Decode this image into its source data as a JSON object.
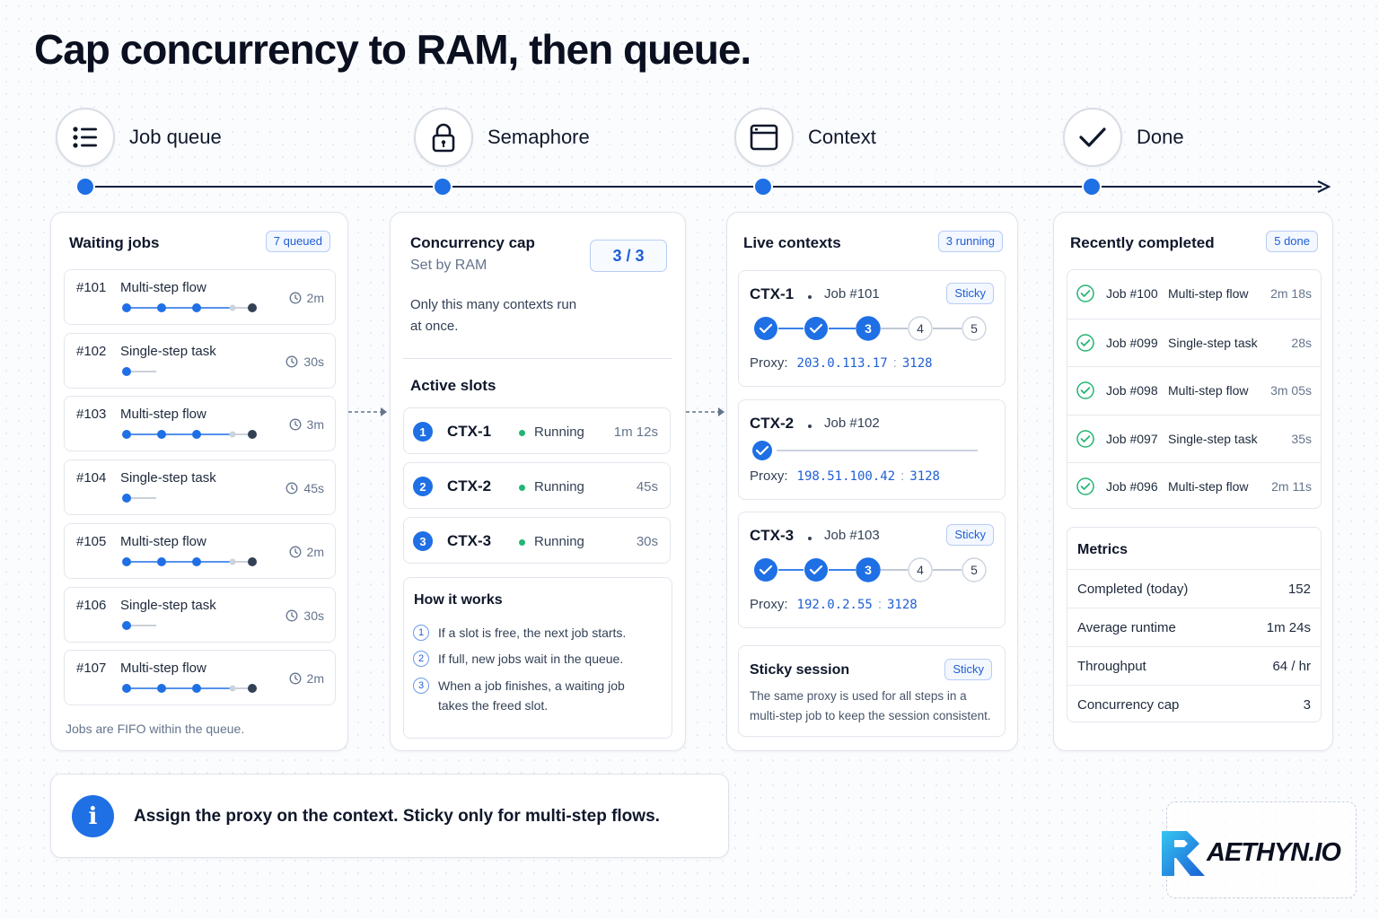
{
  "title": "Cap concurrency to RAM, then queue.",
  "stages": [
    {
      "label": "Job queue",
      "icon": "list-icon"
    },
    {
      "label": "Semaphore",
      "icon": "lock-icon"
    },
    {
      "label": "Context",
      "icon": "browser-window-icon"
    },
    {
      "label": "Done",
      "icon": "checkmark-icon"
    }
  ],
  "colors": {
    "accent": "#1f6fe5",
    "running": "#22b573",
    "done": "#22b573",
    "line": "#0f1f3d"
  },
  "waiting": {
    "title": "Waiting jobs",
    "badge": "7 queued",
    "jobs": [
      {
        "id": "#101",
        "name": "Multi-step flow",
        "time": "2m"
      },
      {
        "id": "#102",
        "name": "Single-step task",
        "time": "30s"
      },
      {
        "id": "#103",
        "name": "Multi-step flow",
        "time": "3m"
      },
      {
        "id": "#104",
        "name": "Single-step task",
        "time": "45s"
      },
      {
        "id": "#105",
        "name": "Multi-step flow",
        "time": "2m"
      },
      {
        "id": "#106",
        "name": "Single-step task",
        "time": "30s"
      },
      {
        "id": "#107",
        "name": "Multi-step flow",
        "time": "2m"
      }
    ],
    "footer": "Jobs are FIFO within the queue."
  },
  "semaphore": {
    "title": "Concurrency cap",
    "subtitle": "Set by RAM",
    "value": "3 / 3",
    "desc_line1": "Only this many contexts run",
    "desc_line2": "at once.",
    "slots_title": "Active slots",
    "slots": [
      {
        "num": "1",
        "name": "CTX-1",
        "status": "Running",
        "time": "1m 12s"
      },
      {
        "num": "2",
        "name": "CTX-2",
        "status": "Running",
        "time": "45s"
      },
      {
        "num": "3",
        "name": "CTX-3",
        "status": "Running",
        "time": "30s"
      }
    ],
    "how_title": "How it works",
    "how": [
      {
        "num": "1",
        "text": "If a slot is free, the next job starts."
      },
      {
        "num": "2",
        "text": "If full, new jobs wait in the queue."
      },
      {
        "num": "3",
        "text": "When a job finishes, a waiting job takes the freed slot."
      }
    ]
  },
  "contexts": {
    "title": "Live contexts",
    "badge": "3 running",
    "proxy_label": "Proxy:",
    "items": [
      {
        "name": "CTX-1",
        "job": "Job #101",
        "sticky": "Sticky",
        "ip": "203.0.113.17",
        "port": "3128",
        "steps": [
          "done",
          "done",
          "3",
          "4",
          "5"
        ]
      },
      {
        "name": "CTX-2",
        "job": "Job #102",
        "sticky": "",
        "ip": "198.51.100.42",
        "port": "3128",
        "steps": [
          "done"
        ]
      },
      {
        "name": "CTX-3",
        "job": "Job #103",
        "sticky": "Sticky",
        "ip": "192.0.2.55",
        "port": "3128",
        "steps": [
          "done",
          "done",
          "3",
          "4",
          "5"
        ]
      }
    ],
    "sticky_title": "Sticky session",
    "sticky_badge": "Sticky",
    "sticky_line1": "The same proxy is used for all steps in a",
    "sticky_line2": "multi-step job to keep the session consistent."
  },
  "completed": {
    "title": "Recently completed",
    "badge": "5 done",
    "jobs": [
      {
        "job": "Job #100",
        "name": "Multi-step flow",
        "time": "2m 18s"
      },
      {
        "job": "Job #099",
        "name": "Single-step task",
        "time": "28s"
      },
      {
        "job": "Job #098",
        "name": "Multi-step flow",
        "time": "3m 05s"
      },
      {
        "job": "Job #097",
        "name": "Single-step task",
        "time": "35s"
      },
      {
        "job": "Job #096",
        "name": "Multi-step flow",
        "time": "2m 11s"
      }
    ],
    "metrics_title": "Metrics",
    "metrics": [
      {
        "label": "Completed (today)",
        "value": "152"
      },
      {
        "label": "Average runtime",
        "value": "1m 24s"
      },
      {
        "label": "Throughput",
        "value": "64 / hr"
      },
      {
        "label": "Concurrency cap",
        "value": "3"
      }
    ]
  },
  "callout": {
    "icon": "info-icon",
    "text": "Assign the proxy on the context. Sticky only for multi-step flows."
  },
  "logo": {
    "text": "AETHYN.IO"
  }
}
